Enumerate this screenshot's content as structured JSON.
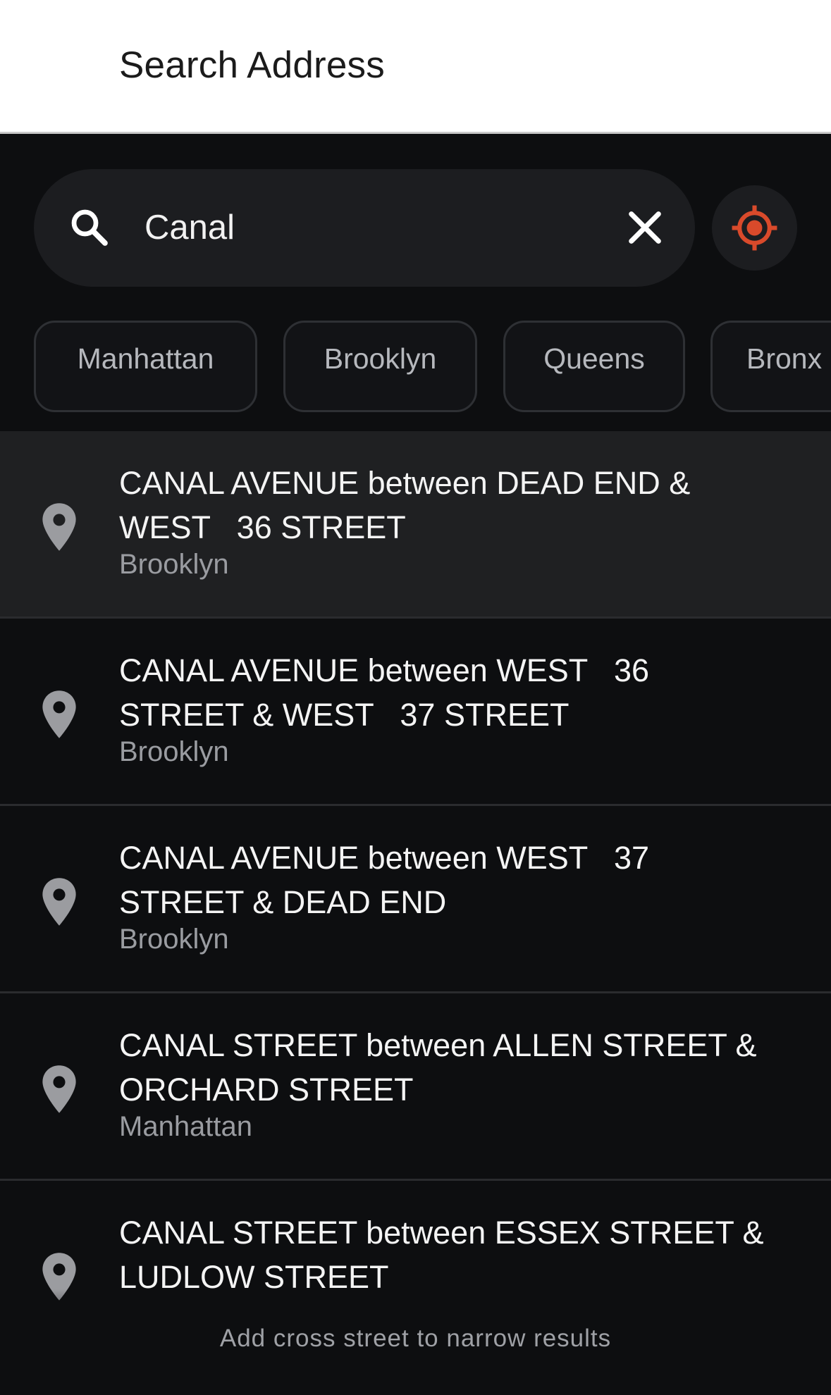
{
  "header": {
    "title": "Search Address"
  },
  "search": {
    "value": "Canal",
    "placeholder": ""
  },
  "filters": [
    {
      "label": "Manhattan"
    },
    {
      "label": "Brooklyn"
    },
    {
      "label": "Queens"
    },
    {
      "label": "Bronx"
    }
  ],
  "results": [
    {
      "title": "CANAL AVENUE between DEAD END &\nWEST   36 STREET",
      "borough": "Brooklyn"
    },
    {
      "title": "CANAL AVENUE between WEST   36\nSTREET & WEST   37 STREET",
      "borough": "Brooklyn"
    },
    {
      "title": "CANAL AVENUE between WEST   37\nSTREET & DEAD END",
      "borough": "Brooklyn"
    },
    {
      "title": "CANAL STREET between ALLEN STREET &\nORCHARD STREET",
      "borough": "Manhattan"
    },
    {
      "title": "CANAL STREET between ESSEX STREET &\nLUDLOW STREET",
      "borough": ""
    }
  ],
  "hint": "Add cross street to narrow results",
  "icons": {
    "search": "search-icon",
    "clear": "close-icon",
    "locate": "crosshair-icon",
    "pin": "map-pin-icon"
  },
  "colors": {
    "accent": "#d94a2b",
    "background": "#0d0e10",
    "header_bg": "#ffffff"
  }
}
